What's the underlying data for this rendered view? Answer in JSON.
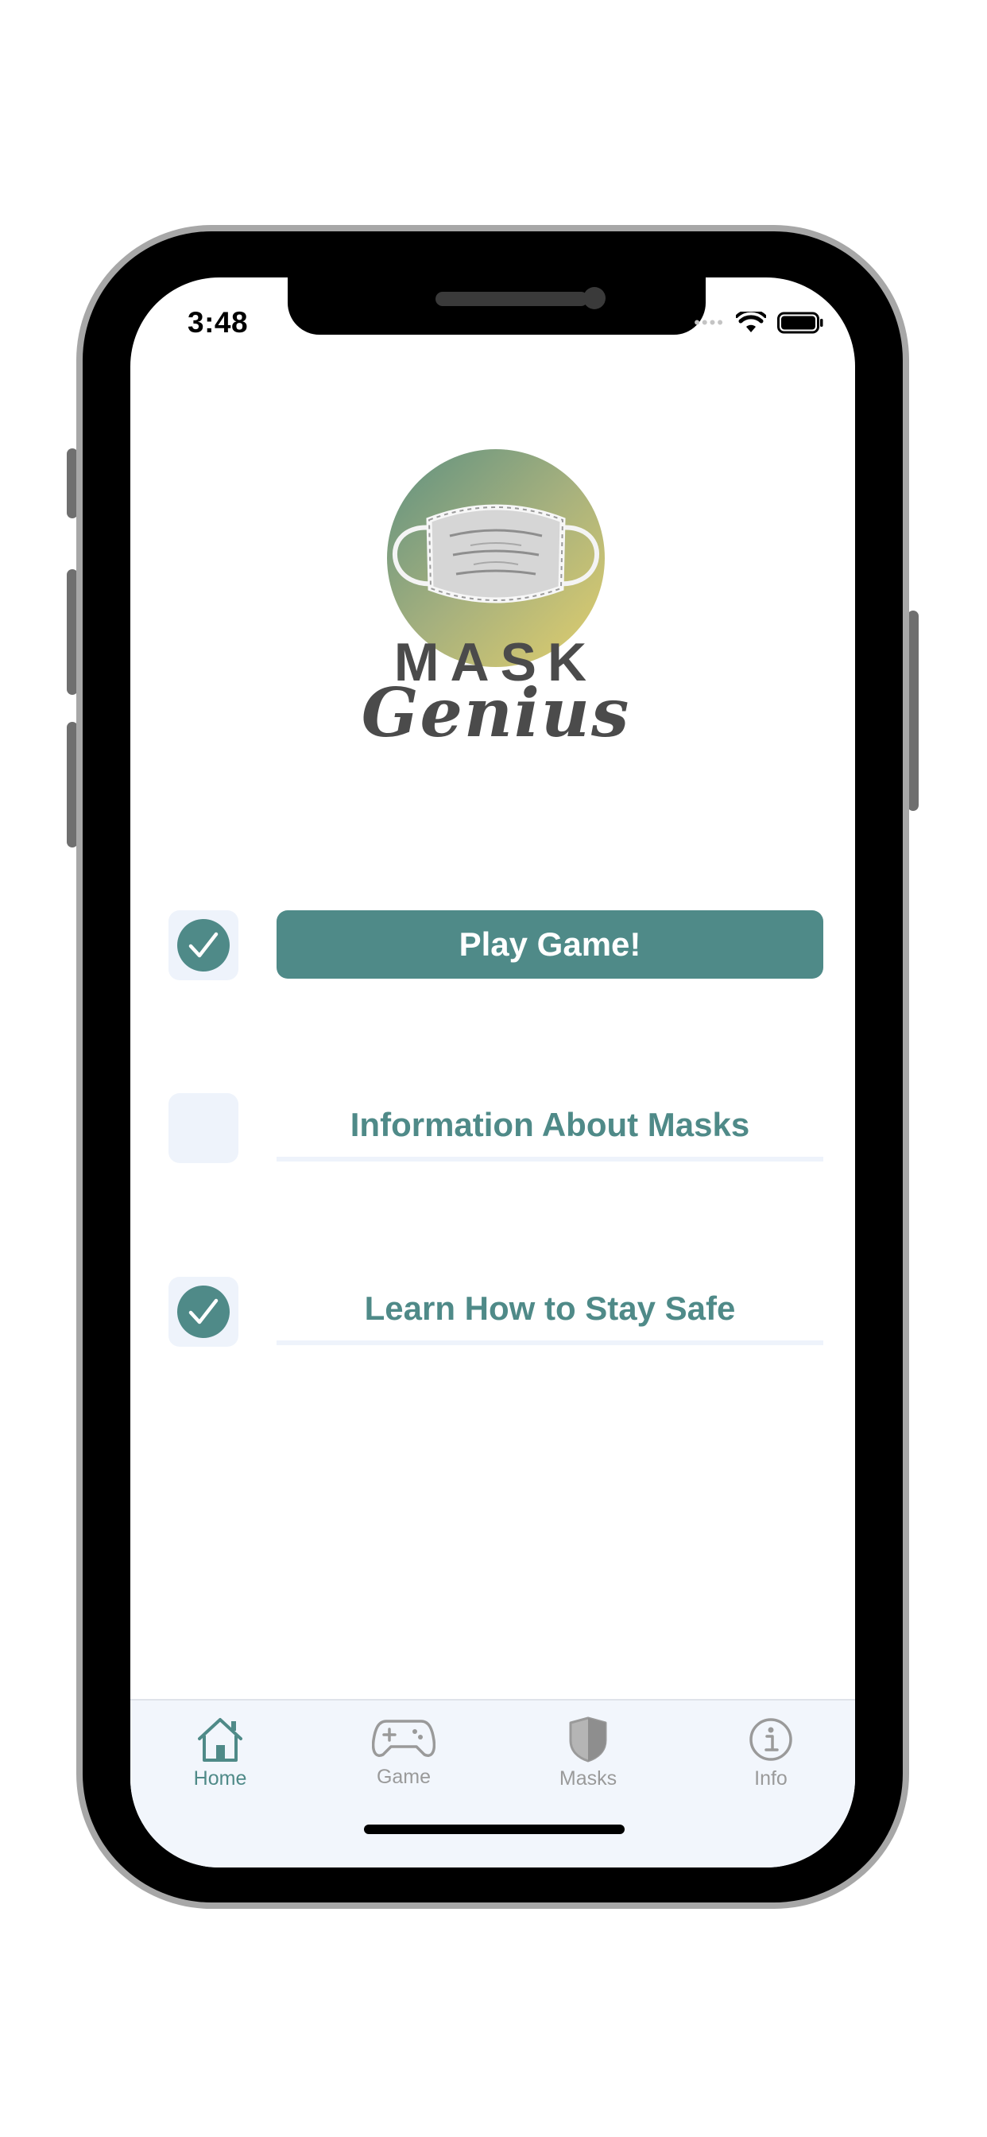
{
  "status_bar": {
    "time": "3:48"
  },
  "logo": {
    "word_top": "MASK",
    "word_bottom": "Genius"
  },
  "menu": [
    {
      "label": "Play Game!",
      "checked": true,
      "style": "primary"
    },
    {
      "label": "Information About Masks",
      "checked": false,
      "style": "link"
    },
    {
      "label": "Learn How to Stay Safe",
      "checked": true,
      "style": "link"
    }
  ],
  "tabbar": {
    "tabs": [
      {
        "label": "Home",
        "icon": "house-icon",
        "active": true
      },
      {
        "label": "Game",
        "icon": "gamepad-icon",
        "active": false
      },
      {
        "label": "Masks",
        "icon": "shield-icon",
        "active": false
      },
      {
        "label": "Info",
        "icon": "info-icon",
        "active": false
      }
    ]
  },
  "colors": {
    "accent": "#4f8a88",
    "checkbox_bg": "#eef3fb",
    "tabbar_bg": "#f2f6fc",
    "inactive": "#9a9a9a"
  }
}
